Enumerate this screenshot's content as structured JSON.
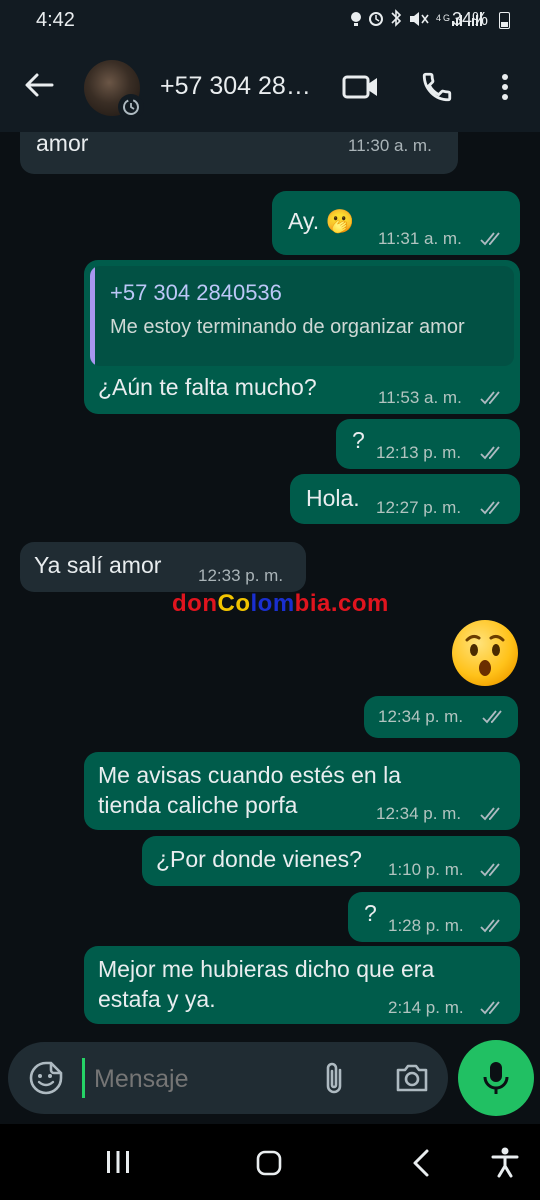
{
  "status_bar": {
    "time": "4:42",
    "battery": "34%",
    "signal_text": "4G"
  },
  "header": {
    "contact_name": "+57 304 28…"
  },
  "watermark": "donColombia.com",
  "messages": [
    {
      "direction": "in",
      "text": "amor",
      "time": "11:30 a. m."
    },
    {
      "direction": "out",
      "text": "Ay. 🫢",
      "time": "11:31 a. m.",
      "status": "read"
    },
    {
      "direction": "out",
      "quote_author": "+57 304 2840536",
      "quote_text": "Me estoy terminando de organizar amor",
      "text": "¿Aún te falta mucho?",
      "time": "11:53 a. m.",
      "status": "read"
    },
    {
      "direction": "out",
      "text": "?",
      "time": "12:13 p. m.",
      "status": "read"
    },
    {
      "direction": "out",
      "text": "Hola.",
      "time": "12:27 p. m.",
      "status": "read"
    },
    {
      "direction": "in",
      "text": "Ya salí amor",
      "time": "12:33 p. m."
    },
    {
      "direction": "out",
      "emoji": "hushed-face",
      "time": "12:34 p. m.",
      "status": "read"
    },
    {
      "direction": "out",
      "text_lines": [
        "Me avisas cuando estés en la",
        "tienda caliche porfa"
      ],
      "time": "12:34 p. m.",
      "status": "read"
    },
    {
      "direction": "out",
      "text": "¿Por donde vienes?",
      "time": "1:10 p. m.",
      "status": "read"
    },
    {
      "direction": "out",
      "text": "?",
      "time": "1:28 p. m.",
      "status": "read"
    },
    {
      "direction": "out",
      "text_lines": [
        "Mejor me hubieras dicho que era",
        "estafa y ya."
      ],
      "time": "2:14 p. m.",
      "status": "read"
    }
  ],
  "composer": {
    "placeholder": "Mensaje"
  },
  "colors": {
    "outgoing_bubble": "#005c4b",
    "incoming_bubble": "#202c33",
    "accent": "#21c063",
    "background": "#0b1014"
  }
}
